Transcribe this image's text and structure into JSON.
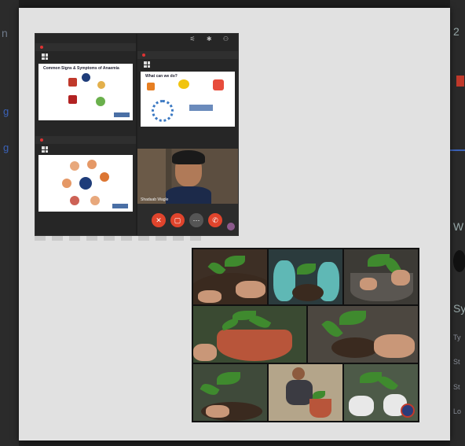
{
  "background": {
    "left_fragment": "n",
    "right_fragments": [
      "2",
      "W",
      "Sy",
      "Ty",
      "St",
      "St",
      "Lo"
    ],
    "blue_fragments": [
      "g",
      "g"
    ]
  },
  "call": {
    "tiles": [
      {
        "title": "Common Signs & Symptoms of Anaemia"
      },
      {
        "title": "What can we do?"
      },
      {
        "title": ""
      }
    ],
    "participant_name": "Shadaab Wagle",
    "controls": [
      "mic-off",
      "video-off",
      "more",
      "end-call"
    ]
  },
  "colors": {
    "sheet": "#e1e1e1",
    "end_call": "#e0442c",
    "leaf": "#3f8a2e"
  }
}
